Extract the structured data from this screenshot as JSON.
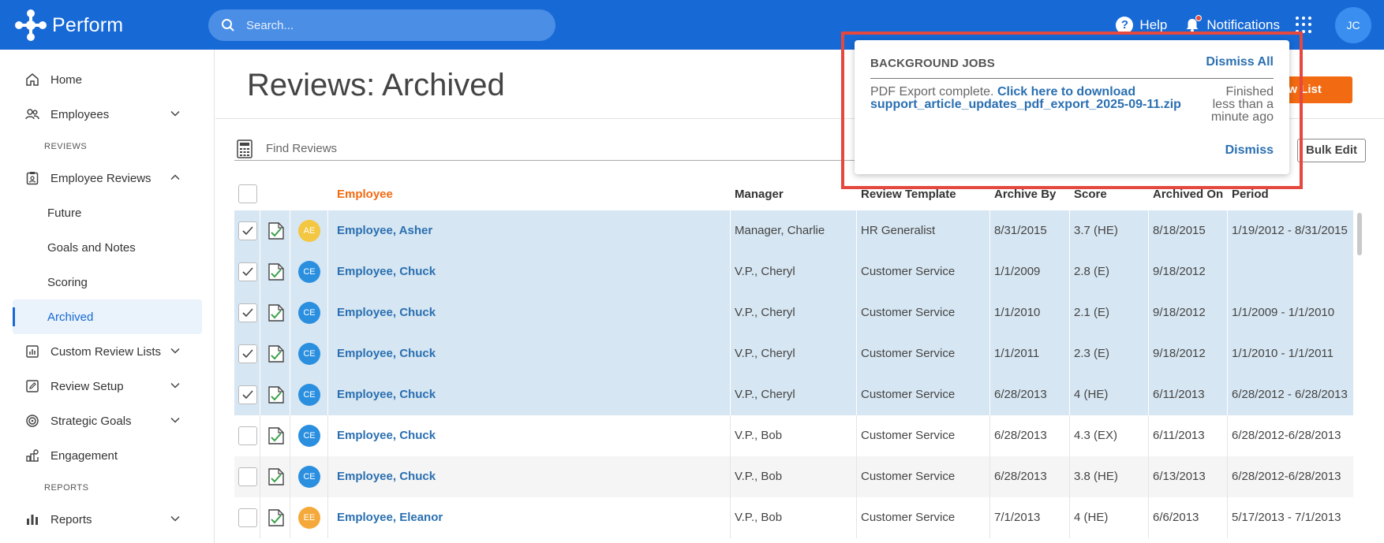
{
  "app": {
    "name": "Perform"
  },
  "topbar": {
    "search_placeholder": "Search...",
    "help_label": "Help",
    "notifications_label": "Notifications",
    "user_initials": "JC"
  },
  "sidebar": {
    "home": "Home",
    "employees": "Employees",
    "section_reviews": "REVIEWS",
    "employee_reviews": "Employee Reviews",
    "sub_future": "Future",
    "sub_goals": "Goals and Notes",
    "sub_scoring": "Scoring",
    "sub_archived": "Archived",
    "custom_review_lists": "Custom Review Lists",
    "review_setup": "Review Setup",
    "strategic_goals": "Strategic Goals",
    "engagement": "Engagement",
    "section_reports": "REPORTS",
    "reports": "Reports"
  },
  "main": {
    "title": "Reviews: Archived",
    "orange_button": "ew List",
    "find_placeholder": "Find Reviews",
    "bulk_edit": "Bulk Edit"
  },
  "table": {
    "columns": {
      "employee": "Employee",
      "manager": "Manager",
      "template": "Review Template",
      "archive_by": "Archive By",
      "score": "Score",
      "archived_on": "Archived On",
      "period": "Period"
    },
    "rows": [
      {
        "initials": "AE",
        "avatar_color": "#f3c742",
        "name": "Employee, Asher",
        "manager": "Manager, Charlie",
        "template": "HR Generalist",
        "archive_by": "8/31/2015",
        "score": "3.7 (HE)",
        "archived_on": "8/18/2015",
        "period": "1/19/2012 - 8/31/2015",
        "checked": true
      },
      {
        "initials": "CE",
        "avatar_color": "#2b8fe0",
        "name": "Employee, Chuck",
        "manager": "V.P., Cheryl",
        "template": "Customer Service",
        "archive_by": "1/1/2009",
        "score": "2.8 (E)",
        "archived_on": "9/18/2012",
        "period": "",
        "checked": true
      },
      {
        "initials": "CE",
        "avatar_color": "#2b8fe0",
        "name": "Employee, Chuck",
        "manager": "V.P., Cheryl",
        "template": "Customer Service",
        "archive_by": "1/1/2010",
        "score": "2.1 (E)",
        "archived_on": "9/18/2012",
        "period": "1/1/2009 - 1/1/2010",
        "checked": true
      },
      {
        "initials": "CE",
        "avatar_color": "#2b8fe0",
        "name": "Employee, Chuck",
        "manager": "V.P., Cheryl",
        "template": "Customer Service",
        "archive_by": "1/1/2011",
        "score": "2.3 (E)",
        "archived_on": "9/18/2012",
        "period": "1/1/2010 - 1/1/2011",
        "checked": true
      },
      {
        "initials": "CE",
        "avatar_color": "#2b8fe0",
        "name": "Employee, Chuck",
        "manager": "V.P., Cheryl",
        "template": "Customer Service",
        "archive_by": "6/28/2013",
        "score": "4 (HE)",
        "archived_on": "6/11/2013",
        "period": "6/28/2012 - 6/28/2013",
        "checked": true
      },
      {
        "initials": "CE",
        "avatar_color": "#2b8fe0",
        "name": "Employee, Chuck",
        "manager": "V.P., Bob",
        "template": "Customer Service",
        "archive_by": "6/28/2013",
        "score": "4.3 (EX)",
        "archived_on": "6/11/2013",
        "period": "6/28/2012-6/28/2013",
        "checked": false
      },
      {
        "initials": "CE",
        "avatar_color": "#2b8fe0",
        "name": "Employee, Chuck",
        "manager": "V.P., Bob",
        "template": "Customer Service",
        "archive_by": "6/28/2013",
        "score": "3.8 (HE)",
        "archived_on": "6/13/2013",
        "period": "6/28/2012-6/28/2013",
        "checked": false
      },
      {
        "initials": "EE",
        "avatar_color": "#f5a93a",
        "name": "Employee, Eleanor",
        "manager": "V.P., Bob",
        "template": "Customer Service",
        "archive_by": "7/1/2013",
        "score": "4 (HE)",
        "archived_on": "6/6/2013",
        "period": "5/17/2013 - 7/1/2013",
        "checked": false
      }
    ]
  },
  "popup": {
    "title": "BACKGROUND JOBS",
    "dismiss_all": "Dismiss All",
    "message_prefix": "PDF Export complete.",
    "link_text": "Click here to download support_article_updates_pdf_export_2025-09-11.zip",
    "time_text": "Finished less than a minute ago",
    "dismiss": "Dismiss"
  },
  "colors": {
    "brand": "#1769d6",
    "accent": "#f26a11",
    "link": "#2a6fb1",
    "highlight_outline": "#e5483f",
    "selected_row": "#d6e6f2"
  }
}
